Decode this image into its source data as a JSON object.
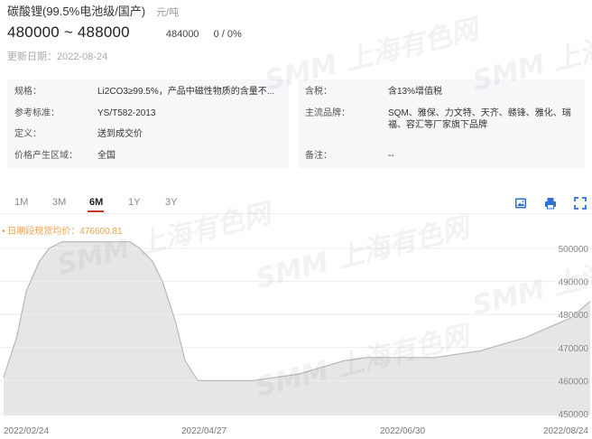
{
  "header": {
    "title": "碳酸锂(99.5%电池级/国产)",
    "unit": "元/吨",
    "price_range": "480000 ~ 488000",
    "avg_price": "484000",
    "change": "0 / 0%",
    "update_date": "更新日期：2022-08-24"
  },
  "watermark": {
    "brand": "SMM",
    "cn": "上海有色网"
  },
  "info_left": [
    {
      "label": "规格：",
      "value": "Li2CO3≥99.5%，产品中磁性物质的含量不..."
    },
    {
      "label": "参考标准：",
      "value": "YS/T582-2013"
    },
    {
      "label": "定义：",
      "value": "送到成交价"
    },
    {
      "label": "价格产生区域：",
      "value": "全国"
    }
  ],
  "info_right": [
    {
      "label": "含税：",
      "value": "含13%增值税"
    },
    {
      "label": "主流品牌：",
      "value": "SQM、雅保、力文特、天齐、赣锋、雅化、瑞福、容汇等厂家旗下品牌"
    },
    {
      "label": "备注：",
      "value": "--"
    }
  ],
  "tabs": [
    {
      "label": "1M",
      "active": false
    },
    {
      "label": "3M",
      "active": false
    },
    {
      "label": "6M",
      "active": true
    },
    {
      "label": "1Y",
      "active": false
    },
    {
      "label": "3Y",
      "active": false
    }
  ],
  "toolbar": {
    "icons": [
      "image-icon",
      "print-icon",
      "fullscreen-icon"
    ]
  },
  "chart": {
    "legend": "日期段现货均价：476600.81"
  },
  "chart_data": {
    "type": "area",
    "title": "",
    "xlabel": "",
    "ylabel": "",
    "series": [
      {
        "name": "日期段现货均价",
        "color": "#cccccc",
        "x": [
          "2022-02-24",
          "2022-02-28",
          "2022-03-03",
          "2022-03-07",
          "2022-03-10",
          "2022-03-14",
          "2022-03-17",
          "2022-03-21",
          "2022-03-24",
          "2022-03-28",
          "2022-03-31",
          "2022-04-04",
          "2022-04-07",
          "2022-04-11",
          "2022-04-14",
          "2022-04-18",
          "2022-04-21",
          "2022-04-25",
          "2022-04-27",
          "2022-05-05",
          "2022-05-12",
          "2022-05-19",
          "2022-05-26",
          "2022-06-02",
          "2022-06-09",
          "2022-06-16",
          "2022-06-23",
          "2022-06-30",
          "2022-07-07",
          "2022-07-14",
          "2022-07-21",
          "2022-07-28",
          "2022-08-04",
          "2022-08-11",
          "2022-08-18",
          "2022-08-24"
        ],
        "values": [
          461000,
          473000,
          487000,
          496000,
          500000,
          502000,
          502000,
          502000,
          502000,
          502000,
          502000,
          502000,
          500000,
          496000,
          490000,
          478000,
          466000,
          460000,
          460000,
          460000,
          460000,
          461000,
          462000,
          464000,
          466000,
          467000,
          467000,
          467000,
          467000,
          468000,
          469000,
          471000,
          473000,
          476000,
          479000,
          484000
        ]
      }
    ],
    "x_tick_labels": [
      "2022/02/24",
      "2022/04/27",
      "2022/06/30",
      "2022/08/24"
    ],
    "ylim": [
      450000,
      500000
    ],
    "y_ticks": [
      450000,
      460000,
      470000,
      480000,
      490000,
      500000
    ],
    "y_tick_labels": [
      "450000",
      "460000",
      "470000",
      "480000",
      "490000",
      "500000"
    ],
    "grid": true
  }
}
